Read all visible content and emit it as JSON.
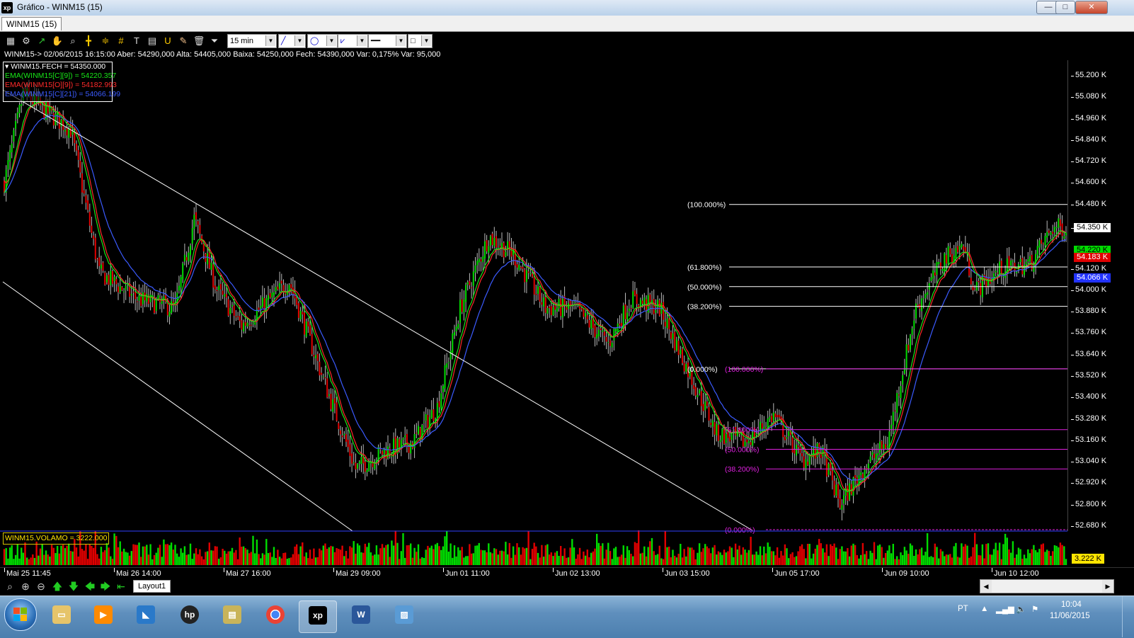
{
  "window": {
    "logo": "xp",
    "title": "Gráfico - WINM15 (15)",
    "buttons": [
      "—",
      "□",
      "✕"
    ]
  },
  "tab": {
    "label": "WINM15 (15)"
  },
  "toolbar": {
    "period": "15 min"
  },
  "info": "WINM15-> 02/06/2015 16:15:00 Aber: 54290,000 Alta: 54405,000 Baixa: 54250,000 Fech: 54390,000 Var: 0,175% Var: 95,000",
  "legend": [
    {
      "text": "▾ WINM15.FECH = 54350.000",
      "color": "#ffffff"
    },
    {
      "text": "EMA(WINM15[C][9]) = 54220.357",
      "color": "#18e818"
    },
    {
      "text": "EMA(WINM15[O][9]) = 54182.993",
      "color": "#ff2a2a"
    },
    {
      "text": "EMA(WINM15[C][21]) = 54066.199",
      "color": "#3b5bff"
    }
  ],
  "volume_label": "WINM15.VOLAMO = 3222.000",
  "volume_badge": "3.222 K",
  "layout_tab": "Layout1",
  "tray": {
    "lang": "PT",
    "time": "10:04",
    "date": "11/06/2015"
  },
  "colors": {
    "up": "#00dc00",
    "down": "#e00000",
    "ema_fast": "#18e818",
    "ema_open": "#ff2a2a",
    "ema_slow": "#3b5bff",
    "fib_white": "#ffffff",
    "fib_magenta": "#e020e0"
  },
  "chart_data": {
    "type": "candlestick",
    "symbol": "WINM15",
    "interval": "15 min",
    "y_ticks": [
      55200,
      55080,
      54960,
      54840,
      54720,
      54600,
      54480,
      54350,
      54120,
      54000,
      53880,
      53760,
      53640,
      53520,
      53400,
      53280,
      53160,
      53040,
      52920,
      52800,
      52680
    ],
    "y_tick_labels": [
      "55.200 K",
      "55.080 K",
      "54.960 K",
      "54.840 K",
      "54.720 K",
      "54.600 K",
      "54.480 K",
      "54.350 K",
      "54.120 K",
      "54.000 K",
      "53.880 K",
      "53.760 K",
      "53.640 K",
      "53.520 K",
      "53.400 K",
      "53.280 K",
      "53.160 K",
      "53.040 K",
      "52.920 K",
      "52.800 K",
      "52.680 K"
    ],
    "ylim": [
      52665,
      55300
    ],
    "x_labels": [
      "Mai 25 11:45",
      "Mai 26 14:00",
      "Mai 27 16:00",
      "Mai 29 09:00",
      "Jun 01 11:00",
      "Jun 02 13:00",
      "Jun 03 15:00",
      "Jun 05 17:00",
      "Jun 09 10:00",
      "Jun 10 12:00"
    ],
    "price_badges": [
      {
        "label": "54.350 K",
        "value": 54350,
        "bg": "#ffffff",
        "fg": "#000000"
      },
      {
        "label": "54.220 K",
        "value": 54220,
        "bg": "#00dc00",
        "fg": "#000000"
      },
      {
        "label": "54.183 K",
        "value": 54183,
        "bg": "#e00000",
        "fg": "#ffffff"
      },
      {
        "label": "54.066 K",
        "value": 54066,
        "bg": "#2233ff",
        "fg": "#ffffff"
      }
    ],
    "path_anchors": [
      [
        0,
        54600
      ],
      [
        10,
        55100
      ],
      [
        22,
        55000
      ],
      [
        35,
        54900
      ],
      [
        50,
        54100
      ],
      [
        70,
        53950
      ],
      [
        90,
        53900
      ],
      [
        100,
        54400
      ],
      [
        112,
        54000
      ],
      [
        125,
        53800
      ],
      [
        140,
        53950
      ],
      [
        150,
        54050
      ],
      [
        168,
        53500
      ],
      [
        185,
        53000
      ],
      [
        200,
        53100
      ],
      [
        215,
        53150
      ],
      [
        228,
        53350
      ],
      [
        240,
        53900
      ],
      [
        255,
        54300
      ],
      [
        268,
        54200
      ],
      [
        285,
        53900
      ],
      [
        300,
        53900
      ],
      [
        318,
        53700
      ],
      [
        330,
        53950
      ],
      [
        345,
        53900
      ],
      [
        360,
        53550
      ],
      [
        375,
        53200
      ],
      [
        390,
        53150
      ],
      [
        405,
        53300
      ],
      [
        420,
        53050
      ],
      [
        430,
        53100
      ],
      [
        440,
        52800
      ],
      [
        452,
        53000
      ],
      [
        465,
        53150
      ],
      [
        480,
        53900
      ],
      [
        495,
        54180
      ],
      [
        505,
        54250
      ],
      [
        511,
        54000
      ],
      [
        525,
        54120
      ],
      [
        540,
        54150
      ],
      [
        552,
        54350
      ],
      [
        559,
        54350
      ]
    ],
    "fibonacci_white": {
      "levels": [
        [
          "(100.000%)",
          54480
        ],
        [
          "(61.800%)",
          54130
        ],
        [
          "(50.000%)",
          54020
        ],
        [
          "(38.200%)",
          53910
        ],
        [
          "(0.000%)",
          53560
        ]
      ]
    },
    "fibonacci_magenta": {
      "levels": [
        [
          "(100.000%)",
          53560
        ],
        [
          "(61.800%)",
          53220
        ],
        [
          "(50.000%)",
          53110
        ],
        [
          "(38.200%)",
          53000
        ],
        [
          "(0.000%)",
          52660
        ]
      ]
    }
  }
}
